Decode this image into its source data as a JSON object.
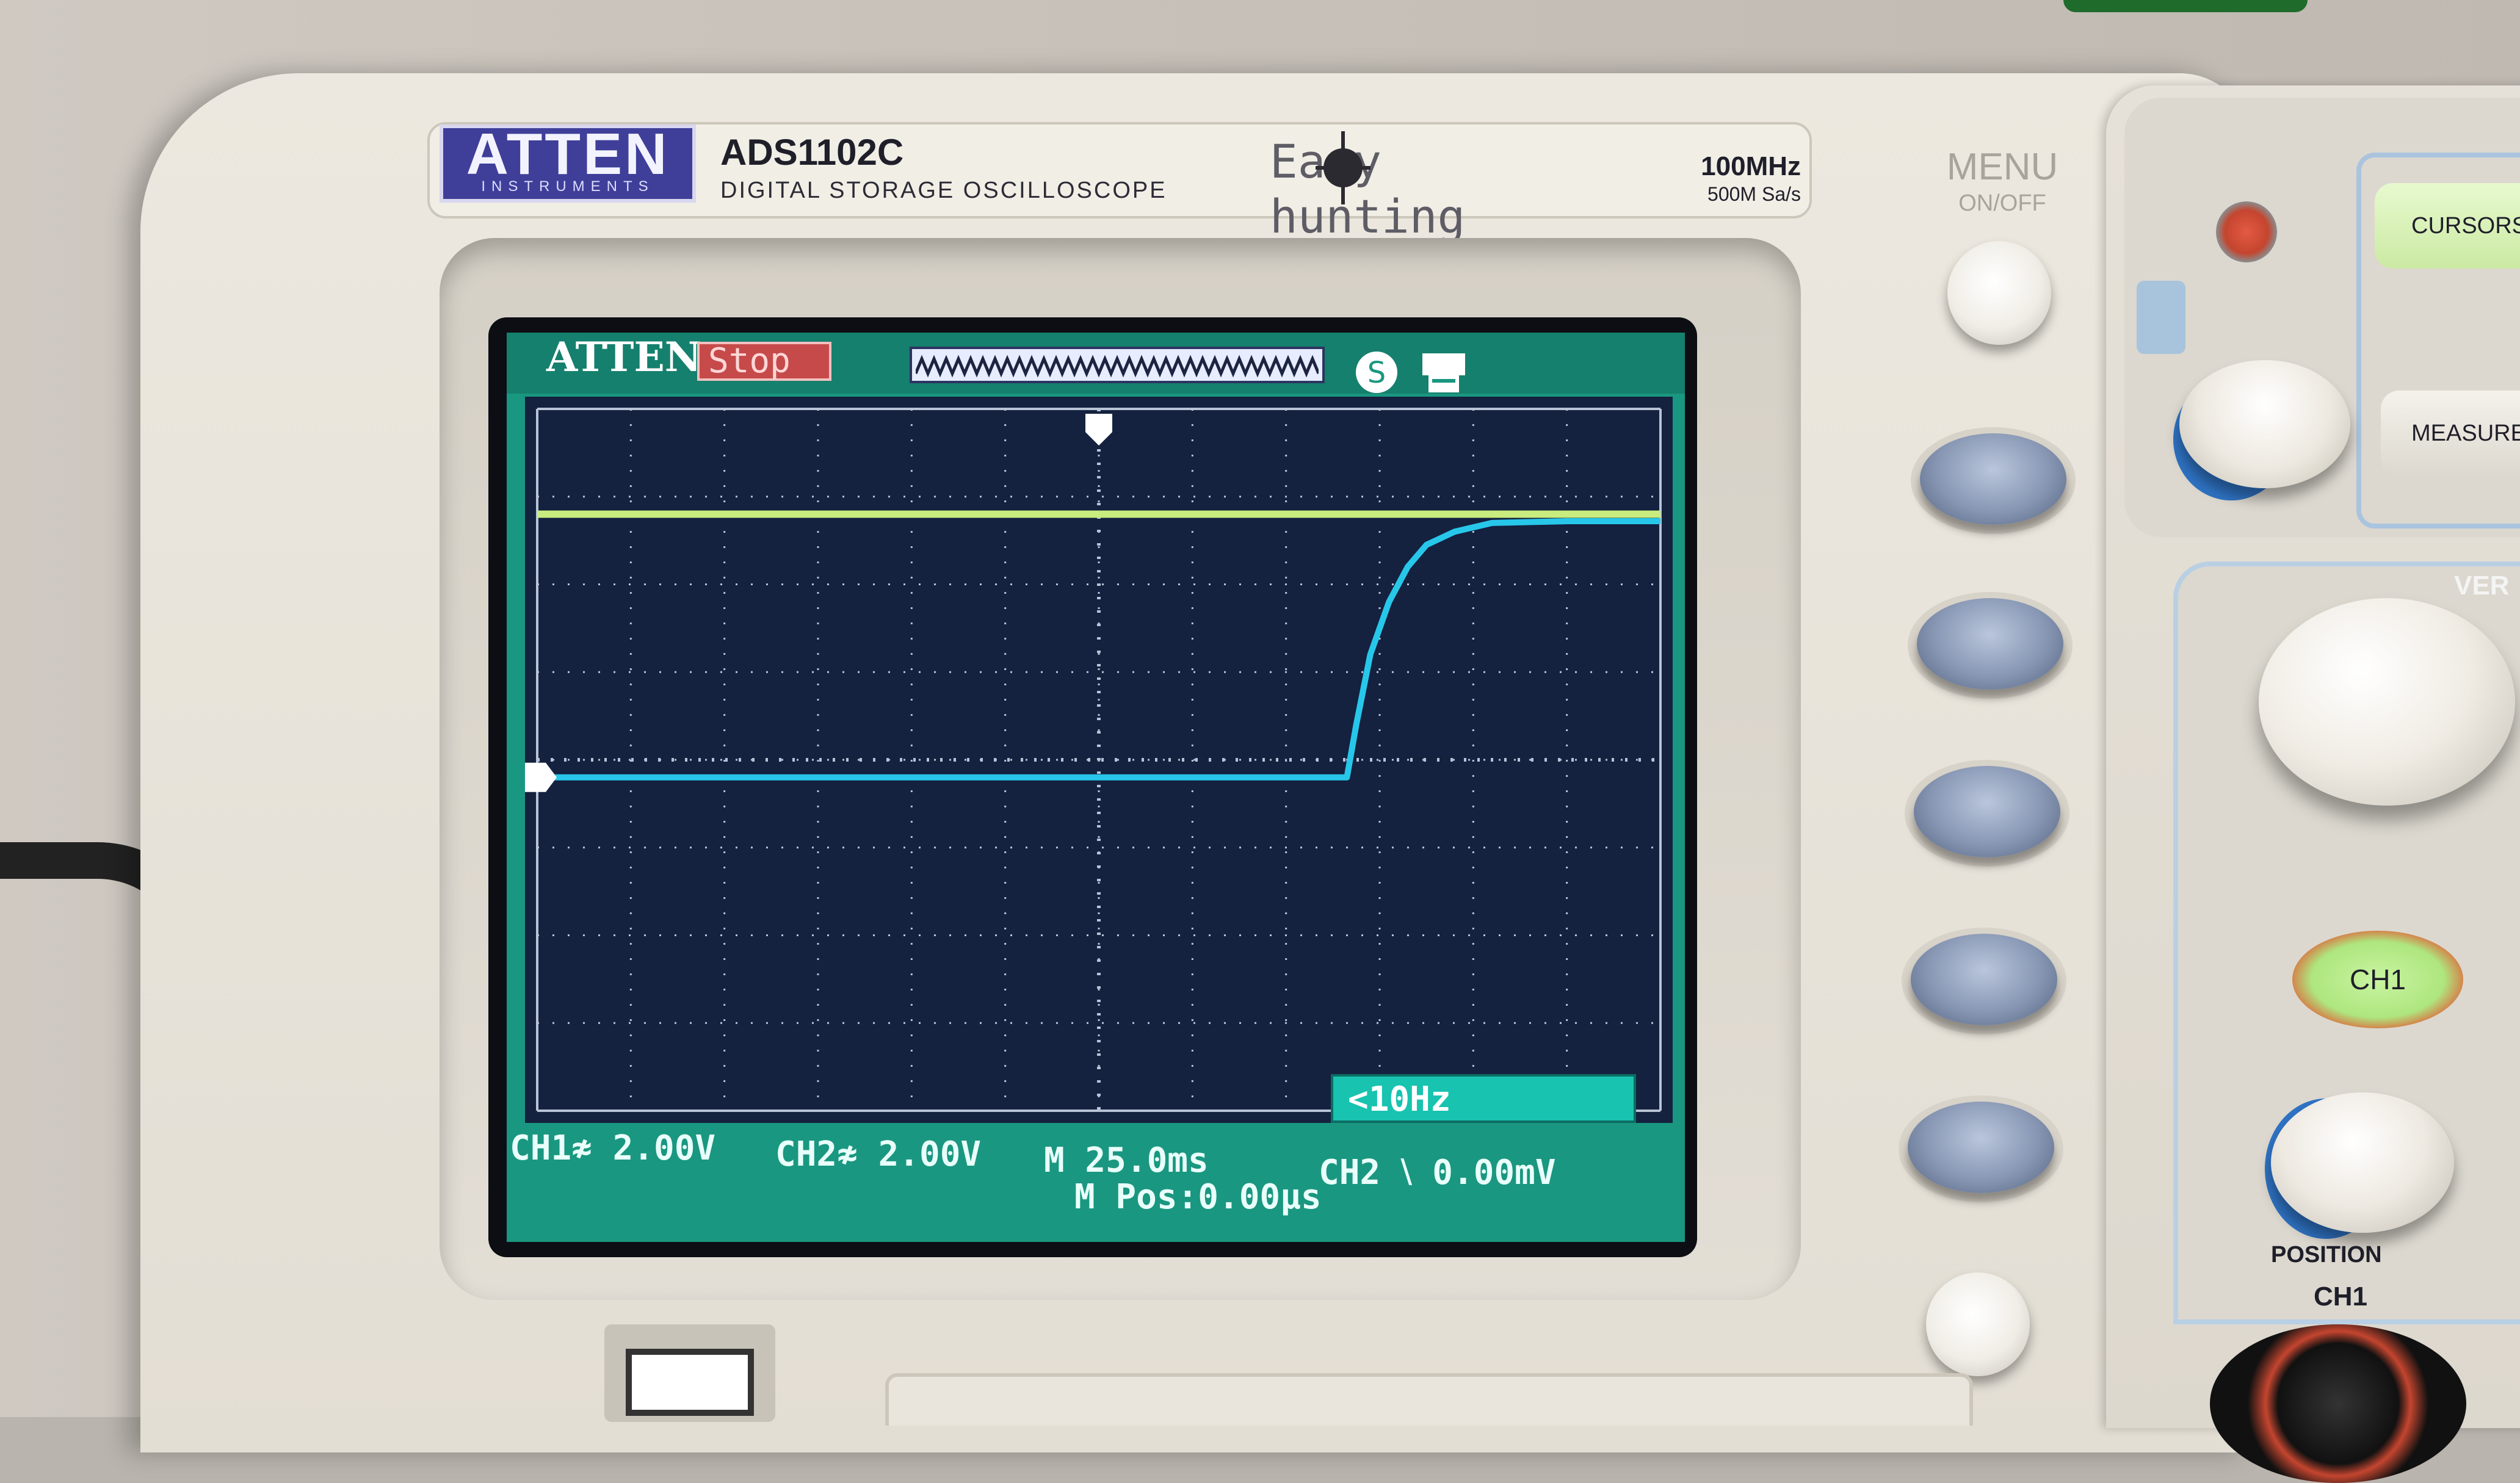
{
  "brand": {
    "name": "ATTEN",
    "sub": "INSTRUMENTS"
  },
  "model": {
    "name": "ADS1102C",
    "description": "DIGITAL STORAGE OSCILLOSCOPE"
  },
  "slogan": "Easy hunting",
  "specs": {
    "bandwidth": "100MHz",
    "sample_rate": "500M Sa/s"
  },
  "menu_button": {
    "label": "MENU",
    "sub": "ON/OFF"
  },
  "screen": {
    "brand": "ATTEN",
    "run_state": "Stop",
    "trigger_frequency": "<10Hz",
    "readouts": {
      "ch1": "CH1≉ 2.00V",
      "ch2": "CH2≉ 2.00V",
      "timebase": "M 25.0ms",
      "position": "M Pos:0.00μs",
      "trigger": "CH2 ⧵ 0.00mV"
    },
    "colors": {
      "background": "#1a9780",
      "plot": "#14213f",
      "ch1_trace": "#c9ec7e",
      "ch2_trace": "#27c7ea",
      "grid": "#b8c3d6"
    }
  },
  "panel": {
    "cursors_label": "CURSORS",
    "measure_label": "MEASURE",
    "vertical_label": "VER",
    "ch1_button": "CH1",
    "position_label": "POSITION",
    "ch1_input_label": "CH1"
  },
  "chart_data": {
    "type": "line",
    "grid": true,
    "x_divisions": 12,
    "y_divisions": 8,
    "series": [
      {
        "name": "CH1",
        "description_of_level": "constant high",
        "x": [
          0,
          12
        ],
        "y": [
          2.8,
          2.8
        ]
      },
      {
        "name": "CH2",
        "x": [
          0,
          8.65,
          8.75,
          8.9,
          9.1,
          9.3,
          9.5,
          9.8,
          10.2,
          11,
          12
        ],
        "y": [
          -0.2,
          -0.2,
          0.4,
          1.2,
          1.8,
          2.2,
          2.45,
          2.6,
          2.7,
          2.72,
          2.72
        ]
      }
    ]
  }
}
